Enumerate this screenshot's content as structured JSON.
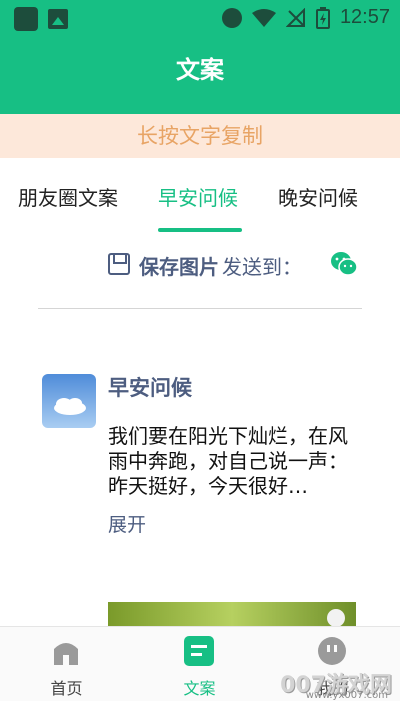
{
  "status_bar": {
    "time": "12:57"
  },
  "header": {
    "title": "文案"
  },
  "notice": {
    "text": "长按文字复制"
  },
  "tabs": [
    {
      "label": "朋友圈文案"
    },
    {
      "label": "早安问候"
    },
    {
      "label": "晚安问候"
    }
  ],
  "save_bar": {
    "save_label": "保存图片",
    "send_label": "发送到："
  },
  "card": {
    "title": "早安问候",
    "body": "我们要在阳光下灿烂，在风雨中奔跑，对自己说一声：昨天挺好，今天很好…",
    "expand_label": "展开"
  },
  "bottom_nav": [
    {
      "label": "首页"
    },
    {
      "label": "文案"
    },
    {
      "label": "我的"
    }
  ],
  "watermark": {
    "text": "007游戏网",
    "sub": "www.yx007.com"
  },
  "colors": {
    "accent": "#17bf84",
    "notice_bg": "#fde8da",
    "notice_text": "#e8a465",
    "link": "#4d5d80"
  }
}
